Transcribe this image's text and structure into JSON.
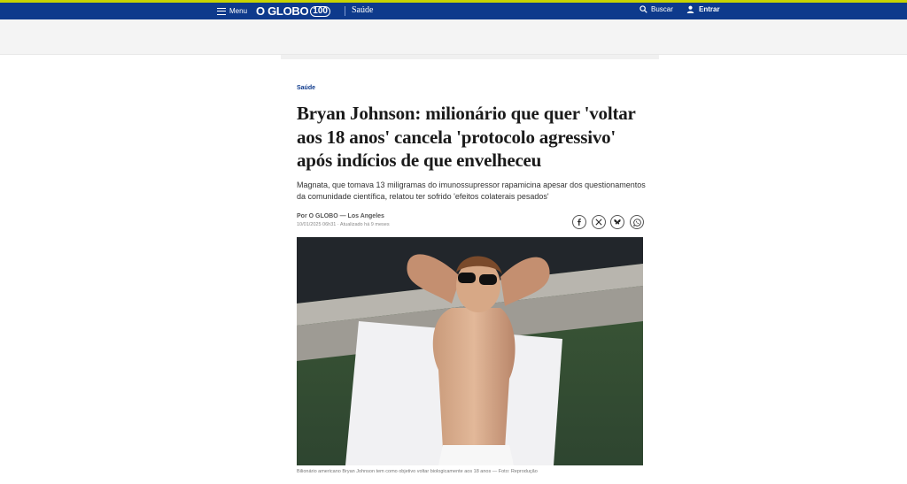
{
  "header": {
    "menu_label": "Menu",
    "logo_text": "O GLOBO",
    "logo_badge": "100",
    "section": "Saúde",
    "search_label": "Buscar",
    "login_label": "Entrar",
    "colors": {
      "brand_blue": "#0e3a8c",
      "accent_stripe": "#c8d400"
    }
  },
  "article": {
    "kicker": "Saúde",
    "headline": "Bryan Johnson: milionário que quer 'voltar aos 18 anos' cancela 'protocolo agressivo' após indícios de que envelheceu",
    "deck": "Magnata, que tomava 13 miligramas do imunossupressor rapamicina apesar dos questionamentos da comunidade científica, relatou ter sofrido 'efeitos colaterais pesados'",
    "byline": "Por O GLOBO — Los Angeles",
    "dateline": "10/01/2025 06h31 · Atualizado há 9 meses",
    "caption": "Bilionário americano Bryan Johnson tem como objetivo voltar biologicamente aos 18 anos — Foto: Reprodução"
  },
  "share_icons": [
    "facebook-icon",
    "x-icon",
    "bluesky-icon",
    "whatsapp-icon"
  ]
}
